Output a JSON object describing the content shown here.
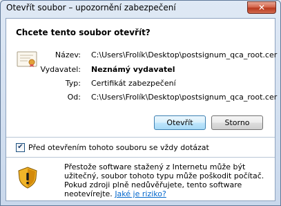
{
  "window": {
    "title": "Otevřít soubor – upozornění zabezpečení",
    "close_label": "✕"
  },
  "dialog": {
    "heading": "Chcete tento soubor otevřít?",
    "rows": [
      {
        "label": "Název:",
        "value": "C:\\Users\\Frolík\\Desktop\\postsignum_qca_root.cer"
      },
      {
        "label": "Vydavatel:",
        "value": "Neznámý vydavatel"
      },
      {
        "label": "Typ:",
        "value": "Certifikát zabezpečení"
      },
      {
        "label": "Od:",
        "value": "C:\\Users\\Frolík\\Desktop\\postsignum_qca_root.cer"
      }
    ],
    "open_button": "Otevřít",
    "cancel_button": "Storno",
    "checkbox_label": "Před otevřením tohoto souboru se vždy dotázat",
    "checkbox_checked": true,
    "checkbox_mark": "✔",
    "warning_text": "Přestože software stažený z Internetu může být užitečný, soubor tohoto typu může poškodit počítač. Pokud zdroji plně nedůvěřujete, tento software neotevírejte.",
    "risk_link": "Jaké je riziko?",
    "icons": {
      "certificate": "certificate-icon",
      "shield": "shield-warning-icon"
    }
  }
}
